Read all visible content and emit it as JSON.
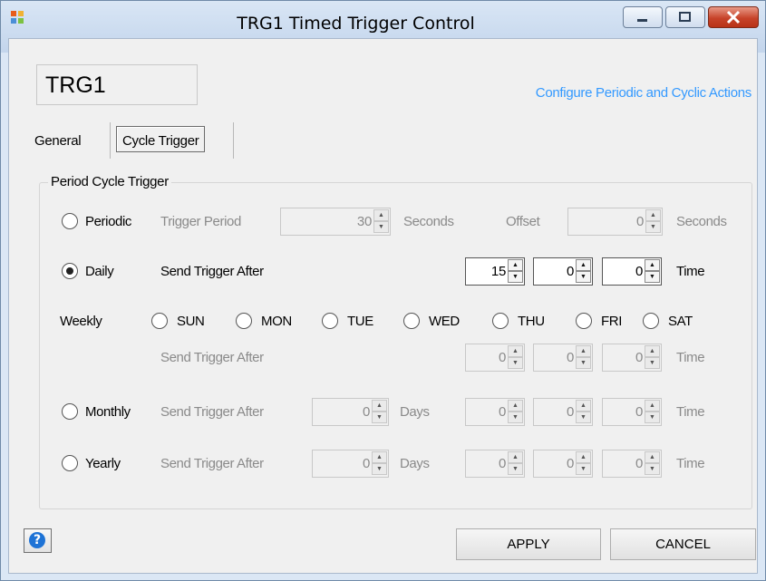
{
  "window": {
    "title": "TRG1 Timed Trigger Control"
  },
  "trigger_name": "TRG1",
  "configure_link": "Configure Periodic and Cyclic Actions",
  "tabs": [
    {
      "label": "General",
      "active": false
    },
    {
      "label": "Cycle Trigger",
      "active": true
    }
  ],
  "group_title": "Period Cycle Trigger",
  "periodic": {
    "label": "Periodic",
    "checked": false,
    "period_label": "Trigger Period",
    "period_value": "30",
    "period_unit": "Seconds",
    "offset_label": "Offset",
    "offset_value": "0",
    "offset_unit": "Seconds"
  },
  "daily": {
    "label": "Daily",
    "checked": true,
    "after_label": "Send Trigger After",
    "h": "15",
    "m": "0",
    "s": "0",
    "unit": "Time"
  },
  "weekly": {
    "label": "Weekly",
    "days": [
      "SUN",
      "MON",
      "TUE",
      "WED",
      "THU",
      "FRI",
      "SAT"
    ],
    "after_label": "Send Trigger After",
    "h": "0",
    "m": "0",
    "s": "0",
    "unit": "Time"
  },
  "monthly": {
    "label": "Monthly",
    "checked": false,
    "after_label": "Send Trigger After",
    "days_value": "0",
    "days_unit": "Days",
    "h": "0",
    "m": "0",
    "s": "0",
    "unit": "Time"
  },
  "yearly": {
    "label": "Yearly",
    "checked": false,
    "after_label": "Send Trigger After",
    "days_value": "0",
    "days_unit": "Days",
    "h": "0",
    "m": "0",
    "s": "0",
    "unit": "Time"
  },
  "buttons": {
    "apply": "APPLY",
    "cancel": "CANCEL",
    "help": "?"
  },
  "icons": {
    "app": "app-icon",
    "minimize": "minimize-icon",
    "maximize": "maximize-icon",
    "close": "close-icon",
    "help": "help-icon",
    "spin_up": "up-arrow-icon",
    "spin_down": "down-arrow-icon"
  },
  "colors": {
    "link": "#3399ff",
    "close_button": "#c7432a",
    "help": "#1e73d6",
    "disabled_text": "#8a8a8a"
  }
}
